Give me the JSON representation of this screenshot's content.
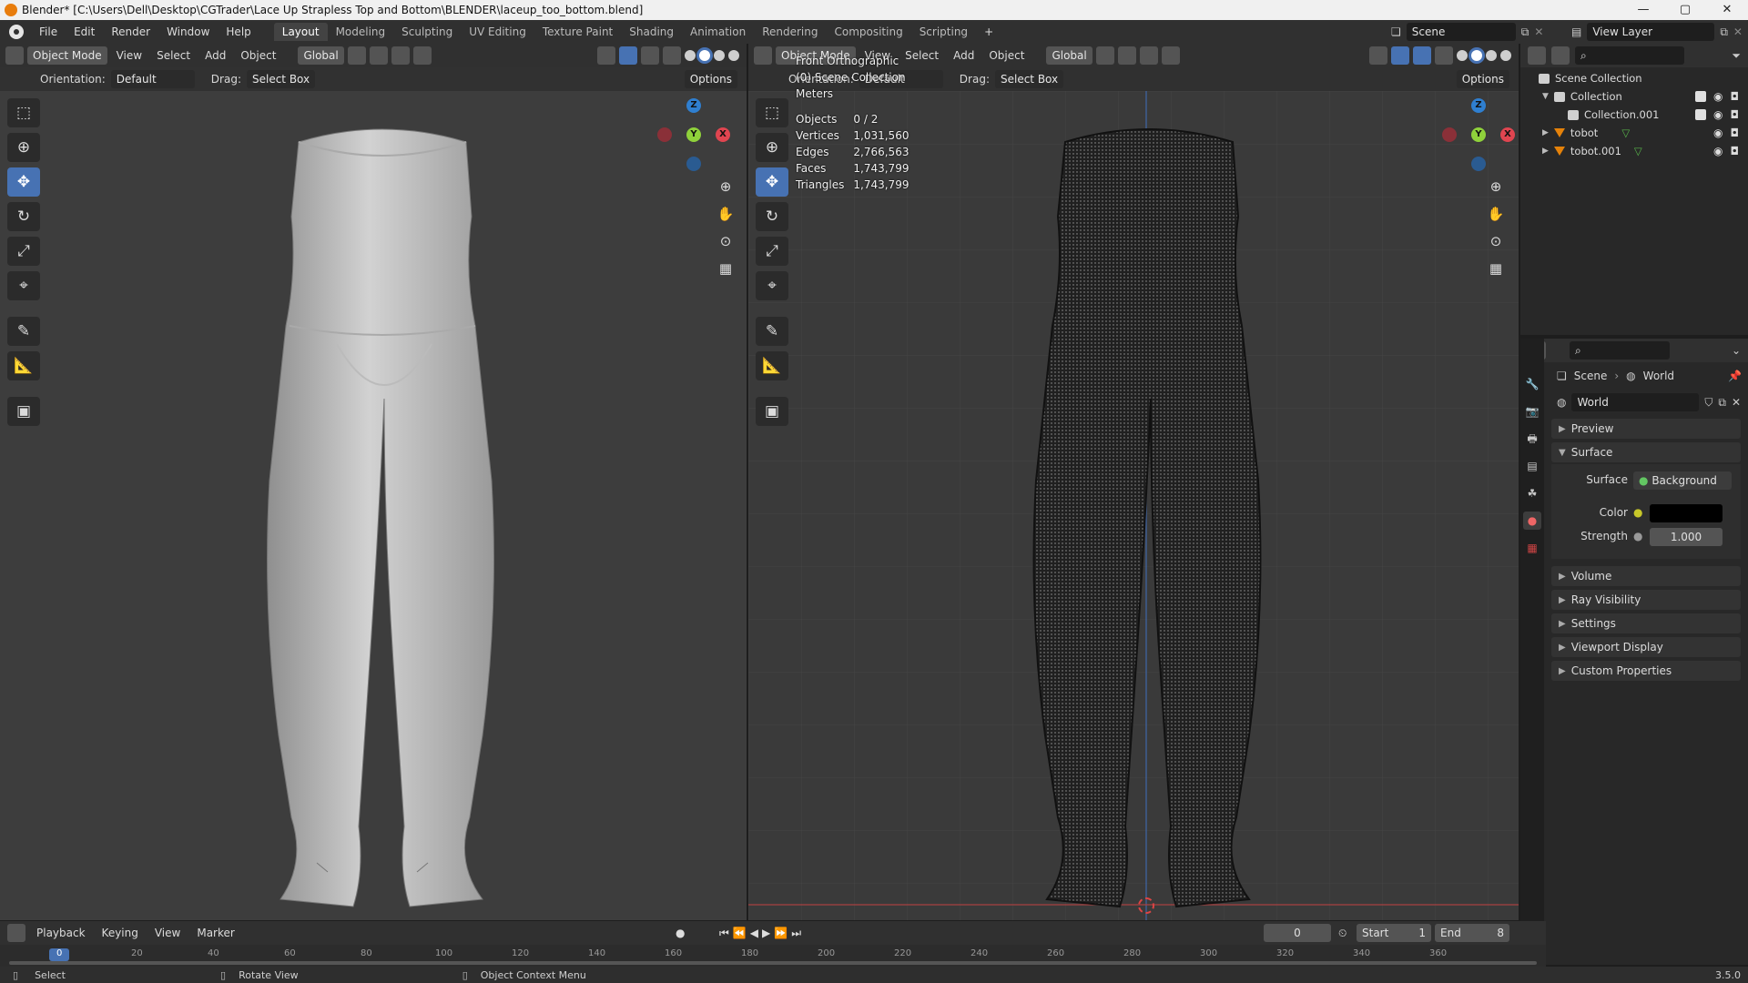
{
  "window": {
    "title": "Blender* [C:\\Users\\Dell\\Desktop\\CGTrader\\Lace Up Strapless Top and Bottom\\BLENDER\\laceup_too_bottom.blend]",
    "controls": [
      "—",
      "▢",
      "✕"
    ]
  },
  "menu": {
    "items": [
      "File",
      "Edit",
      "Render",
      "Window",
      "Help"
    ],
    "workspaces": [
      "Layout",
      "Modeling",
      "Sculpting",
      "UV Editing",
      "Texture Paint",
      "Shading",
      "Animation",
      "Rendering",
      "Compositing",
      "Scripting"
    ],
    "add_workspace": "+",
    "scene": "Scene",
    "view_layer": "View Layer"
  },
  "viewport_left": {
    "mode": "Object Mode",
    "menus": [
      "View",
      "Select",
      "Add",
      "Object"
    ],
    "transform": "Global",
    "orientation_label": "Orientation:",
    "orientation_value": "Default",
    "drag_label": "Drag:",
    "drag_value": "Select Box",
    "options": "Options"
  },
  "viewport_right": {
    "mode": "Object Mode",
    "menus": [
      "View",
      "Select",
      "Add",
      "Object"
    ],
    "transform": "Global",
    "orientation_label": "Orientation:",
    "orientation_value": "Default",
    "drag_label": "Drag:",
    "drag_value": "Select Box",
    "options": "Options",
    "view_name": "Front Orthographic",
    "collection_info": "(0) Scene Collection",
    "units": "Meters",
    "stats": [
      {
        "label": "Objects",
        "value": "0 / 2"
      },
      {
        "label": "Vertices",
        "value": "1,031,560"
      },
      {
        "label": "Edges",
        "value": "2,766,563"
      },
      {
        "label": "Faces",
        "value": "1,743,799"
      },
      {
        "label": "Triangles",
        "value": "1,743,799"
      }
    ]
  },
  "gizmo": {
    "z": "Z",
    "y": "Y",
    "x": "X"
  },
  "outliner": {
    "root": "Scene Collection",
    "items": [
      {
        "label": "Collection"
      },
      {
        "label": "Collection.001"
      },
      {
        "label": "tobot"
      },
      {
        "label": "tobot.001"
      }
    ]
  },
  "properties": {
    "breadcrumb_scene": "Scene",
    "breadcrumb_sep": "›",
    "breadcrumb_world": "World",
    "world_name": "World",
    "sections": {
      "preview": "Preview",
      "surface": "Surface",
      "volume": "Volume",
      "ray_visibility": "Ray Visibility",
      "settings": "Settings",
      "viewport_display": "Viewport Display",
      "custom_properties": "Custom Properties"
    },
    "surface_label": "Surface",
    "surface_value": "Background",
    "color_label": "Color",
    "color_value": "#000000",
    "strength_label": "Strength",
    "strength_value": "1.000"
  },
  "timeline": {
    "menus": [
      "Playback",
      "Keying",
      "View",
      "Marker"
    ],
    "current_frame": "0",
    "start_label": "Start",
    "start_value": "1",
    "end_label": "End",
    "end_value": "8",
    "ruler": [
      "0",
      "20",
      "40",
      "60",
      "80",
      "100",
      "120",
      "140",
      "160",
      "180",
      "200",
      "220",
      "240",
      "260",
      "280",
      "300",
      "320",
      "340",
      "360"
    ]
  },
  "statusbar": {
    "select": "Select",
    "rotate": "Rotate View",
    "context": "Object Context Menu",
    "version": "3.5.0"
  }
}
